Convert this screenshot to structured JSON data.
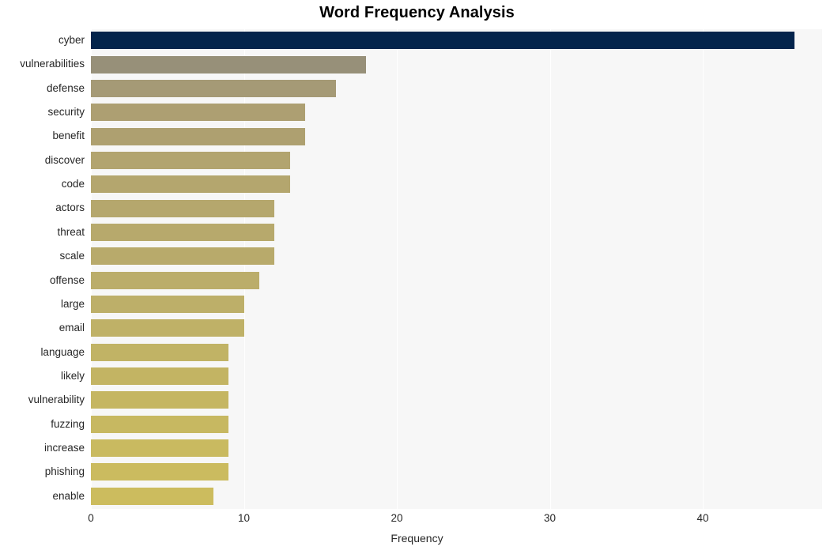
{
  "chart_data": {
    "type": "bar",
    "orientation": "horizontal",
    "title": "Word Frequency Analysis",
    "xlabel": "Frequency",
    "ylabel": "",
    "categories": [
      "cyber",
      "vulnerabilities",
      "defense",
      "security",
      "benefit",
      "discover",
      "code",
      "actors",
      "threat",
      "scale",
      "offense",
      "large",
      "email",
      "language",
      "likely",
      "vulnerability",
      "fuzzing",
      "increase",
      "phishing",
      "enable"
    ],
    "values": [
      46,
      18,
      16,
      14,
      14,
      13,
      13,
      12,
      12,
      12,
      11,
      10,
      10,
      9,
      9,
      9,
      9,
      9,
      9,
      8
    ],
    "xlim": [
      0,
      47.8
    ],
    "xticks": [
      0,
      10,
      20,
      30,
      40
    ],
    "xtick_labels": [
      "0",
      "10",
      "20",
      "30",
      "40"
    ],
    "grid": true,
    "grid_axis": "x",
    "legend": "none",
    "bar_colors": [
      "#04244c",
      "#979079",
      "#a59a76",
      "#ad9f72",
      "#aea070",
      "#b2a46f",
      "#b4a66e",
      "#b5a76d",
      "#b7a96c",
      "#b8aa6b",
      "#bbad6a",
      "#bdaf69",
      "#bfb167",
      "#c1b365",
      "#c3b463",
      "#c5b662",
      "#c7b861",
      "#c9ba60",
      "#cbbb5f",
      "#ccbc5e"
    ],
    "plot_background": "#f7f7f7",
    "gridline_color": "#ffffff",
    "text_color": "#262626",
    "title_color": "#000000"
  }
}
